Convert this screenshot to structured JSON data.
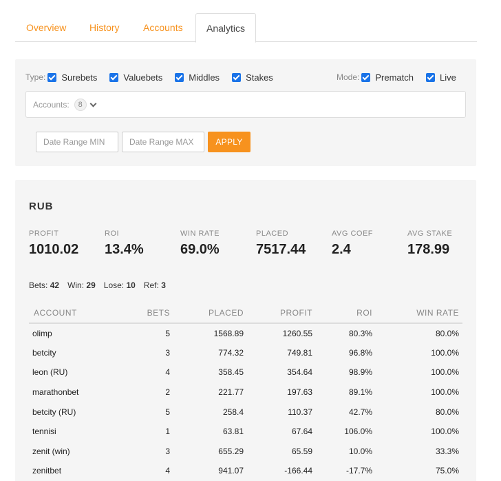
{
  "tabs": [
    {
      "label": "Overview",
      "active": false
    },
    {
      "label": "History",
      "active": false
    },
    {
      "label": "Accounts",
      "active": false
    },
    {
      "label": "Analytics",
      "active": true
    }
  ],
  "filters": {
    "type_label": "Type:",
    "types": [
      {
        "label": "Surebets",
        "checked": true
      },
      {
        "label": "Valuebets",
        "checked": true
      },
      {
        "label": "Middles",
        "checked": true
      },
      {
        "label": "Stakes",
        "checked": true
      }
    ],
    "mode_label": "Mode:",
    "modes": [
      {
        "label": "Prematch",
        "checked": true
      },
      {
        "label": "Live",
        "checked": true
      }
    ],
    "accounts_label": "Accounts:",
    "accounts_count": "8",
    "date_min_placeholder": "Date Range MIN",
    "date_max_placeholder": "Date Range MAX",
    "apply_label": "APPLY"
  },
  "colors": {
    "accent": "#f7921e",
    "checkbox": "#1a73e8",
    "panel_bg": "#f5f5f5"
  },
  "stats": {
    "currency": "RUB",
    "metrics": [
      {
        "label": "PROFIT",
        "value": "1010.02"
      },
      {
        "label": "ROI",
        "value": "13.4%"
      },
      {
        "label": "WIN RATE",
        "value": "69.0%"
      },
      {
        "label": "PLACED",
        "value": "7517.44"
      },
      {
        "label": "AVG COEF",
        "value": "2.4"
      },
      {
        "label": "AVG STAKE",
        "value": "178.99"
      }
    ],
    "summary": {
      "bets_label": "Bets:",
      "bets": "42",
      "win_label": "Win:",
      "win": "29",
      "lose_label": "Lose:",
      "lose": "10",
      "ref_label": "Ref:",
      "ref": "3"
    },
    "table": {
      "headers": [
        "ACCOUNT",
        "BETS",
        "PLACED",
        "PROFIT",
        "ROI",
        "WIN RATE"
      ],
      "rows": [
        [
          "olimp",
          "5",
          "1568.89",
          "1260.55",
          "80.3%",
          "80.0%"
        ],
        [
          "betcity",
          "3",
          "774.32",
          "749.81",
          "96.8%",
          "100.0%"
        ],
        [
          "leon (RU)",
          "4",
          "358.45",
          "354.64",
          "98.9%",
          "100.0%"
        ],
        [
          "marathonbet",
          "2",
          "221.77",
          "197.63",
          "89.1%",
          "100.0%"
        ],
        [
          "betcity (RU)",
          "5",
          "258.4",
          "110.37",
          "42.7%",
          "80.0%"
        ],
        [
          "tennisi",
          "1",
          "63.81",
          "67.64",
          "106.0%",
          "100.0%"
        ],
        [
          "zenit (win)",
          "3",
          "655.29",
          "65.59",
          "10.0%",
          "33.3%"
        ],
        [
          "zenitbet",
          "4",
          "941.07",
          "-166.44",
          "-17.7%",
          "75.0%"
        ]
      ]
    }
  }
}
